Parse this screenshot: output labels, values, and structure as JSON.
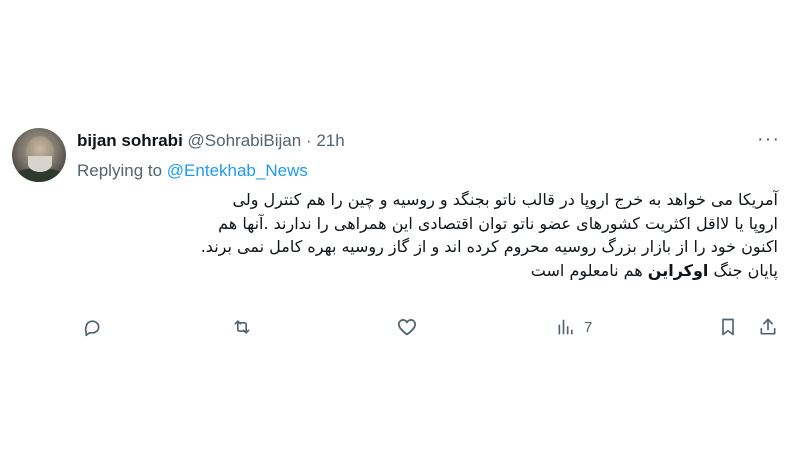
{
  "tweet": {
    "display_name": "bijan sohrabi",
    "handle": "@SohrabiBijan",
    "separator": "·",
    "time": "21h",
    "more_label": "···",
    "replying_prefix": "Replying to",
    "replying_to": "@Entekhab_News",
    "body_lines": [
      "آمریکا می خواهد به خرج اروپا در قالب ناتو بجنگد و روسیه و چین را هم کنترل ولی",
      "اروپا یا لااقل اکثریت کشورهای عضو ناتو توان اقتصادی این همراهی را ندارند .آنها هم",
      "اکنون خود را از بازار بزرگ روسیه محروم کرده اند و از گاز روسیه بهره کامل نمی برند.",
      "پایان جنگ"
    ],
    "body_bold_word": "اوکراین",
    "body_last_suffix": "هم نامعلوم است"
  },
  "actions": {
    "reply": {
      "icon": "reply-icon",
      "count": ""
    },
    "retweet": {
      "icon": "retweet-icon",
      "count": ""
    },
    "like": {
      "icon": "heart-icon",
      "count": ""
    },
    "views": {
      "icon": "views-icon",
      "count": "7"
    },
    "bookmark": {
      "icon": "bookmark-icon",
      "count": ""
    },
    "share": {
      "icon": "share-icon",
      "count": ""
    }
  },
  "colors": {
    "text": "#0f1419",
    "secondary": "#536471",
    "link": "#1d9bf0",
    "background": "#ffffff"
  }
}
